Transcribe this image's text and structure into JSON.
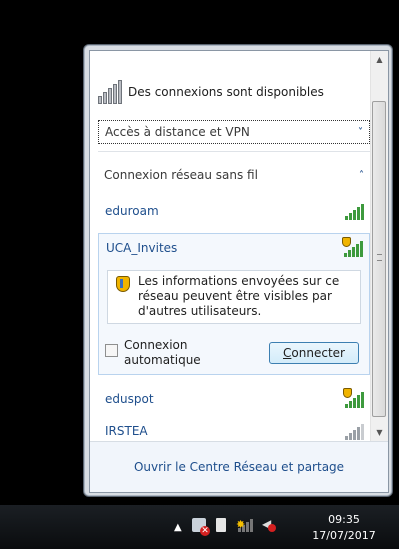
{
  "header": {
    "title": "Des connexions sont disponibles"
  },
  "sections": {
    "vpn": {
      "label": "Accès à distance et VPN"
    },
    "wireless": {
      "label": "Connexion réseau sans fil"
    }
  },
  "networks": [
    {
      "name": "eduroam",
      "secured": false,
      "signal": "full"
    },
    {
      "name": "UCA_Invites",
      "secured": true,
      "signal": "full"
    },
    {
      "name": "eduspot",
      "secured": true,
      "signal": "full"
    },
    {
      "name": "IRSTEA",
      "secured": false,
      "signal": "weak"
    }
  ],
  "expanded": {
    "warning": "Les informations envoyées sur ce réseau peuvent être visibles par d'autres utilisateurs.",
    "auto_connect_label": "Connexion automatique",
    "auto_connect_checked": false,
    "connect_button": "Connecter"
  },
  "footer": {
    "link": "Ouvrir le Centre Réseau et partage"
  },
  "taskbar": {
    "time": "09:35",
    "date": "17/07/2017"
  },
  "icons": {
    "tray_arrow": "▲",
    "chevron_down": "˅",
    "chevron_up": "˄"
  },
  "colors": {
    "link": "#1e4e8c",
    "signal": "#3d9a3d",
    "shield": "#f0b400"
  }
}
